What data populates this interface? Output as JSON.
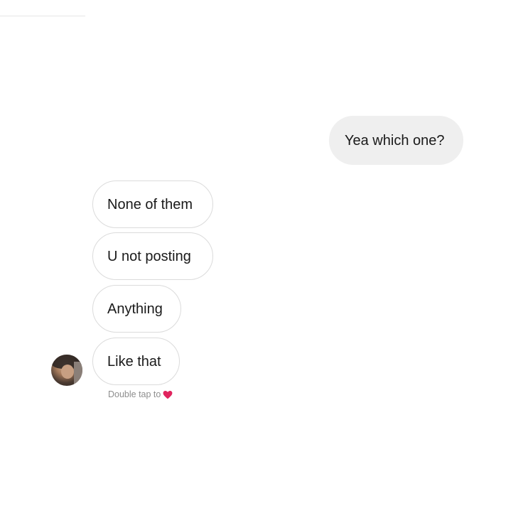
{
  "thread": {
    "outgoing": [
      {
        "text": "Yea which one?"
      }
    ],
    "incoming": [
      {
        "text": "None of them"
      },
      {
        "text": "U not posting"
      },
      {
        "text": "Anything"
      },
      {
        "text": "Like that"
      }
    ],
    "hint": "Double tap to",
    "hint_icon": "heart-icon"
  },
  "colors": {
    "background": "#ffffff",
    "outgoing_bubble": "#efefef",
    "incoming_border": "#dbdbdb",
    "text": "#1a1a1a",
    "hint_text": "#8e8e8e",
    "heart": "#e0245e"
  }
}
